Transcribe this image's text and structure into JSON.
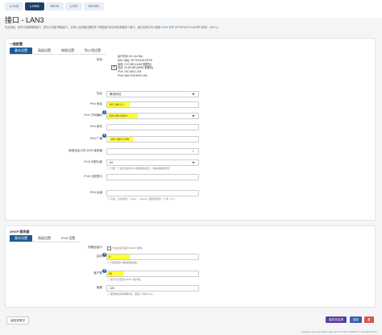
{
  "tabs": [
    "LAN2",
    "LAN3",
    "WAN",
    "LAN",
    "WANX"
  ],
  "active_tab": 1,
  "page_title": "接口 - LAN3",
  "page_desc": "在此页面，您可以配置网络接口。您可以勾选“桥接接口”，并填入由空格分隔的多个网络接口的名称来桥接多个接口。接口名称中可以使用",
  "page_desc_link": "VLAN",
  "page_desc_tail": "记号 INTERFACE.VLANNR (例如：eth0.1)。",
  "general": {
    "title": "一般配置",
    "subtabs": [
      "基本设置",
      "高级设置",
      "物理设置",
      "防火墙设置"
    ],
    "status_label": "状态",
    "status": {
      "uptime": "运行时间: 0h 11m 54s",
      "mac": "MAC 地址: 2E:79:93:54:E5:F8",
      "rx": "接收: 2.37 MB (11465 数据包)",
      "tx": "发送: 24.93 MB (16982 数据包)",
      "ipv4": "IPv4: 192.168.3.1/24",
      "ipv6": "IPv6: fd61:37ef:8ef3:1:/64"
    },
    "protocol_label": "协议",
    "protocol_value": "静态地址",
    "ipv4_addr_label": "IPv4 地址",
    "ipv4_addr_value": "192.168.3.1",
    "ipv4_mask_label": "IPv4 子网掩码",
    "ipv4_mask_value": "255.255.255.0",
    "ipv4_gw_label": "IPv4 网关",
    "ipv4_bcast_label": "IPv4 广播",
    "ipv4_bcast_value": "192.168.3.255",
    "dns_label": "使用自定义的 DNS 服务器",
    "ipv6_assign_label": "IPv6 分配长度",
    "ipv6_assign_value": "64",
    "ipv6_assign_hint": "分配一个此长度的 IPv6 前缀给此接口，或禁用前缀分配",
    "ipv6_hint_label": "IPv6 分配提示",
    "ipv6_suffix_label": "IPv6 后缀",
    "ipv6_suffix_hint": "可选。允许的值：'eui64'，'random' 和固定值如 '::1' 或 '::1:2'。",
    "badges": [
      "1",
      "2",
      "3"
    ]
  },
  "dhcp": {
    "title": "DHCP 服务器",
    "subtabs": [
      "基本设置",
      "高级设置",
      "IPv6 设置"
    ],
    "ignore_label": "忽略此接口",
    "ignore_hint": "不在此接口提供 DHCP 服务。",
    "start_label": "启动",
    "start_value": "5",
    "start_hint": "分配给客户端的起始地址。",
    "limit_label": "客户数",
    "limit_value": "80",
    "limit_hint": "最大可分配的 DHCP 客户数。",
    "lease_label": "租期",
    "lease_value": "12h",
    "lease_hint": "租用地址的到期时间，最短 2 分钟 (2m)。",
    "badges": [
      "4",
      "5"
    ]
  },
  "buttons": {
    "back": "返回至概况",
    "save_apply": "保存并应用",
    "save": "保存",
    "reset": "复位"
  },
  "colors": {
    "primary": "#1c5a94",
    "nav_active": "#1c3f66",
    "highlight": "#ffff33",
    "save_apply": "#5b3fa0",
    "save": "#3a5fb0",
    "reset": "#d9534f"
  },
  "footer": "Powered by LuCI Master (git-20.174.57390-1d44077) / OpenWrt 19.07"
}
